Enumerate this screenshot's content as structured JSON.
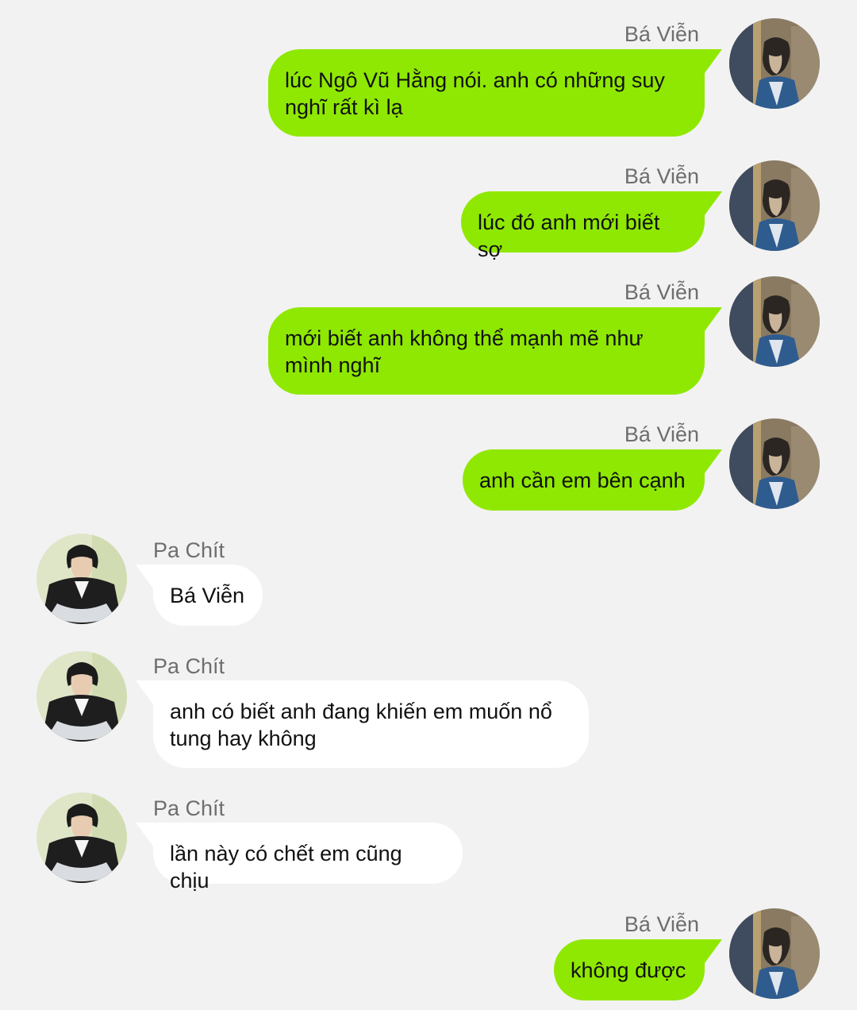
{
  "colors": {
    "background": "#f2f2f2",
    "outgoing_bubble": "#8fe801",
    "incoming_bubble": "#ffffff",
    "sender_name": "#6e6e6e"
  },
  "participants": {
    "self": {
      "name": "Bá Viễn",
      "avatar_icon": "ba-vien-avatar"
    },
    "other": {
      "name": "Pa Chít",
      "avatar_icon": "pa-chit-avatar"
    }
  },
  "messages": [
    {
      "direction": "outgoing",
      "sender": "Bá Viễn",
      "text": "lúc Ngô Vũ Hằng nói. anh có những suy nghĩ rất kì lạ"
    },
    {
      "direction": "outgoing",
      "sender": "Bá Viễn",
      "text": "lúc đó anh mới biết sợ"
    },
    {
      "direction": "outgoing",
      "sender": "Bá Viễn",
      "text": "mới biết anh không thể mạnh mẽ như mình nghĩ"
    },
    {
      "direction": "outgoing",
      "sender": "Bá Viễn",
      "text": "anh cần em bên cạnh"
    },
    {
      "direction": "incoming",
      "sender": "Pa Chít",
      "text": "Bá Viễn"
    },
    {
      "direction": "incoming",
      "sender": "Pa Chít",
      "text": "anh có biết anh đang khiến em muốn nổ tung hay không"
    },
    {
      "direction": "incoming",
      "sender": "Pa Chít",
      "text": "lần này có chết em cũng chịu"
    },
    {
      "direction": "outgoing",
      "sender": "Bá Viễn",
      "text": "không được"
    }
  ]
}
